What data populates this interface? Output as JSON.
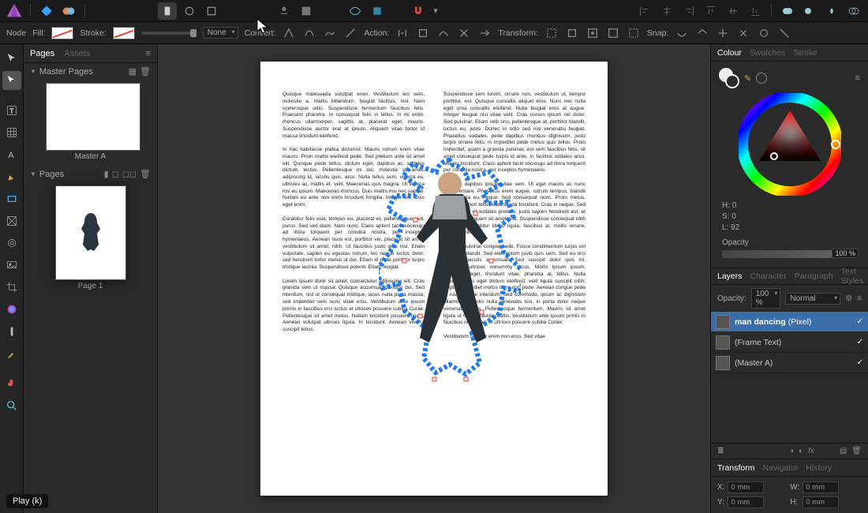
{
  "toolbar": {
    "play_label": "Play (k)"
  },
  "contextbar": {
    "node": "Node",
    "fill": "Fill:",
    "stroke": "Stroke:",
    "none": "None",
    "convert": "Convert:",
    "action": "Action:",
    "transform": "Transform:",
    "snap": "Snap:"
  },
  "left_panel": {
    "tabs": [
      "Pages",
      "Assets"
    ],
    "active_tab": "Pages",
    "master_section": "Master Pages",
    "master_label": "Master A",
    "pages_section": "Pages",
    "page_label": "Page 1"
  },
  "colour_panel": {
    "tabs": [
      "Colour",
      "Swatches",
      "Stroke"
    ],
    "active_tab": "Colour",
    "h": "H: 0",
    "s": "S: 0",
    "l": "L: 92",
    "opacity_label": "Opacity",
    "opacity_value": "100 %"
  },
  "layers_panel": {
    "tabs": [
      "Layers",
      "Character",
      "Paragraph",
      "Text Styles"
    ],
    "active_tab": "Layers",
    "opacity_label": "Opacity:",
    "opacity_value": "100 %",
    "blend": "Normal",
    "layers": [
      {
        "name": "man dancing",
        "kind": "(Pixel)",
        "selected": true
      },
      {
        "name": "(Frame Text)",
        "kind": "",
        "selected": false
      },
      {
        "name": "(Master A)",
        "kind": "",
        "selected": false
      }
    ]
  },
  "transform_panel": {
    "tabs": [
      "Transform",
      "Navigator",
      "History"
    ],
    "active_tab": "Transform",
    "x_label": "X:",
    "x_value": "0 mm",
    "y_label": "Y:",
    "y_value": "0 mm",
    "w_label": "W:",
    "w_value": "0 mm",
    "h_label": "H:",
    "h_value": "0 mm"
  },
  "document": {
    "left_col": "Quisque malesuada volutpat enim. Vestibulum leo sem, molestie a, mattis bibendum, feugiat facilisis, nisl. Nam scelerisque odio. Suspendisse fermentum faucibus felis. Praesent pharetra. In consequat felis in tellus. In mi enim, rhoncus ullamcorper, sagittis at, placerat eget, mauris. Suspendisse auctor erat at ipsum. Aliquam vitae tortor id massa tincidunt eleifend.\n\nIn hac habitasse platea dictumst. Mauris rutrum enim vitae mauris. Proin mattis eleifend pede. Sed pretium ante sit amet elit. Quisque pede tellus, dictum eget, dapibus ac, sodales dictum, lectus. Pellentesque mi dui, molestie sit amet, adipiscing id, iaculis quis, arcu. Nulla tellus sem, viverra eu, ultricies ac, mattis et, velit. Maecenas quis magna. Ut viverra nisl eu ipsum. Maecenas rhoncus. Duis mattis nisi nec sapien. Nullam eu ante non enim tincidunt fringilla. Integer leo. Duis eget enim.\n\nCurabitur felis erat, tempus eu, placerat et, pellentesque sed, purus. Sed sed diam. Nam nunc. Class aptent taciti sociosqu ad litora torquent per conubia nostra, per inceptos hymenaeos. Aenean risus est, porttitor vel, placerat sit amet, vestibulum sit amet, nibh. Ut faucibus justo quis nisl. Etiam vulputate, sapien eu egestas rutrum, leo neque luctus dolor, sed hendrerit tortor metus ut dui. Etiam id pede porttitor turpis tristique lacinia. Suspendisse potenti. Etiam feugiat.\n\nLorem ipsum dolor sit amet, consectetur adipiscing elit. Cras gravida sem ut massa. Quisque accumsan porttitor dui. Sed interdum, nisl ut consequat tristique, lacus nulla porta massa, sed imperdiet sem nunc vitae eros. Vestibulum ante ipsum primis in faucibus orci luctus et ultrices posuere cubilia Curae; Pellentesque sit amet metus. Nullam tincidunt posuere ligula. Aenean volutpat ultrices ligula. In tincidunt. Aenean viverra suscipit tellus.",
    "right_col": "Suspendisse sem lorem, ornare non, vestibulum ut, tempor porttitor, est. Quisque convallis aliquet eros. Nunc nec nulla eget urna convallis eleifend. Nulla feugiat eros at augue. Integer feugiat nisi vitae velit. Cras cursus ipsum vel dolor. Sed pulvinar. Etiam velit orci, pellentesque at, porttitor blandit, luctus eu, justo. Donec in odio sed nisl venenatis feugiat. Phasellus sodales, pede dapibus rhoncus dignissim, justo turpis ornare felis, in imperdiet pede metus quis tellus. Proin imperdiet, quam a gravida pulvinar, est sem faucibus felis, sit amet consequat pede turpis id ante. In facilisis sodales arcu. Mauris tincidunt. Class aptent taciti sociosqu ad litora torquent per conubia nostra, per inceptos hymenaeos.\n\nAliquam dapibus ipsum vitae sem. Ut eget mauris ac nunc luctus ornare. Phasellus enim augue, rutrum tempus, blandit in, vehicula eu, neque. Sed consequat nunc. Proin metus. Duis at mi non tellus malesuada tincidunt. Cras in neque. Sed lacinia, felis ut sodales pretium, justo sapien hendrerit est, et convallis nisi quam sit amet erat. Suspendisse consequat nibh a mauris. Curabitur libero ligula, faucibus at, mollis ornare, mattis et, libero.\n\nAliquam pulvinar congue pede. Fusce condimentum turpis vel dolor. Ut blandit. Sed elementum justo quis sem. Sed eu orci eu ante iaculis accumsan. Sed suscipit dolor quis mi. Curabitur ultrices nonummy lacus. Morbi ipsum ipsum, adipiscing eget, tincidunt vitae, pharetra at, tellus. Nulla gravida, arcu eget dictum eleifend, velit ligula suscipit nibh, sagittis imperdiet metus nunc non pede. Aenean congue pede in nisi tristique interdum. Sed commodo, ipsum ac dignissim ullamcorper, odio nulla venenatis nisi, in porta dolor neque venenatis lacus. Pellentesque fermentum. Mauris sit amet ligula ut tellus gravida mattis. Vestibulum ante ipsum primis in faucibus orci luctus et ultrices posuere cubilia Curae;\n\nVestibulum semper enim non eros. Sed vitae"
  }
}
